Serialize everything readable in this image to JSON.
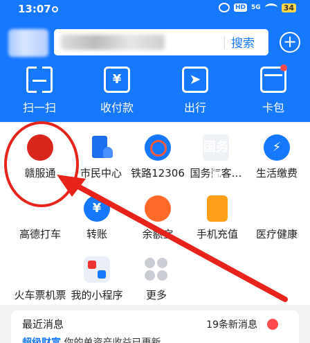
{
  "status_bar": {
    "time": "13:07",
    "network": "5G",
    "hd": "HD",
    "battery": "34"
  },
  "header": {
    "search_button": "搜索",
    "plus_label": "+"
  },
  "top_actions": [
    {
      "label": "扫一扫",
      "icon": "scan-icon"
    },
    {
      "label": "收付款",
      "icon": "payment-icon",
      "glyph": "¥"
    },
    {
      "label": "出行",
      "icon": "travel-icon",
      "glyph": "➤"
    },
    {
      "label": "卡包",
      "icon": "card-wallet-icon"
    }
  ],
  "grid": [
    {
      "label": "赣服通",
      "icon": "ganfutong-icon"
    },
    {
      "label": "市民中心",
      "icon": "citizen-center-icon"
    },
    {
      "label": "铁路12306",
      "icon": "railway-icon"
    },
    {
      "label": "国务院客…",
      "icon": "state-council-icon",
      "glyph": "国务院"
    },
    {
      "label": "生活缴费",
      "icon": "utility-payment-icon",
      "glyph": "⚡"
    },
    {
      "label": "高德打车",
      "icon": "gaode-taxi-icon",
      "glyph": "⟡"
    },
    {
      "label": "转账",
      "icon": "transfer-icon",
      "glyph": "¥"
    },
    {
      "label": "余额宝",
      "icon": "yuebao-icon"
    },
    {
      "label": "手机充值",
      "icon": "phone-recharge-icon"
    },
    {
      "label": "医疗健康",
      "icon": "health-icon",
      "glyph": "♥"
    },
    {
      "label": "火车票机票",
      "icon": "train-ticket-icon",
      "glyph": "✈"
    },
    {
      "label": "我的小程序",
      "icon": "mini-program-icon"
    },
    {
      "label": "更多",
      "icon": "more-icon"
    }
  ],
  "news": {
    "title": "最近消息",
    "count": "19条新消息",
    "first_item_source": "超级财富",
    "first_item_text": "你的单资产收益已更新"
  },
  "colors": {
    "header_blue": "#1677ff",
    "annotation_red": "#e8231c"
  }
}
